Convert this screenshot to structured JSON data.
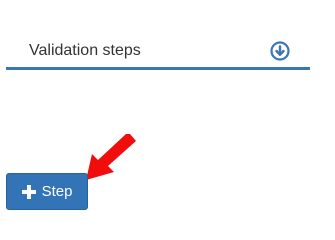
{
  "section": {
    "title": "Validation steps",
    "icon": "download-circle-icon"
  },
  "add_button": {
    "label": "Step",
    "icon": "plus-icon"
  },
  "annotation": {
    "icon": "red-arrow-pointer",
    "color": "#f20d0d"
  },
  "colors": {
    "accent": "#3274b5",
    "underline": "#3b76b0",
    "text": "#333333"
  }
}
